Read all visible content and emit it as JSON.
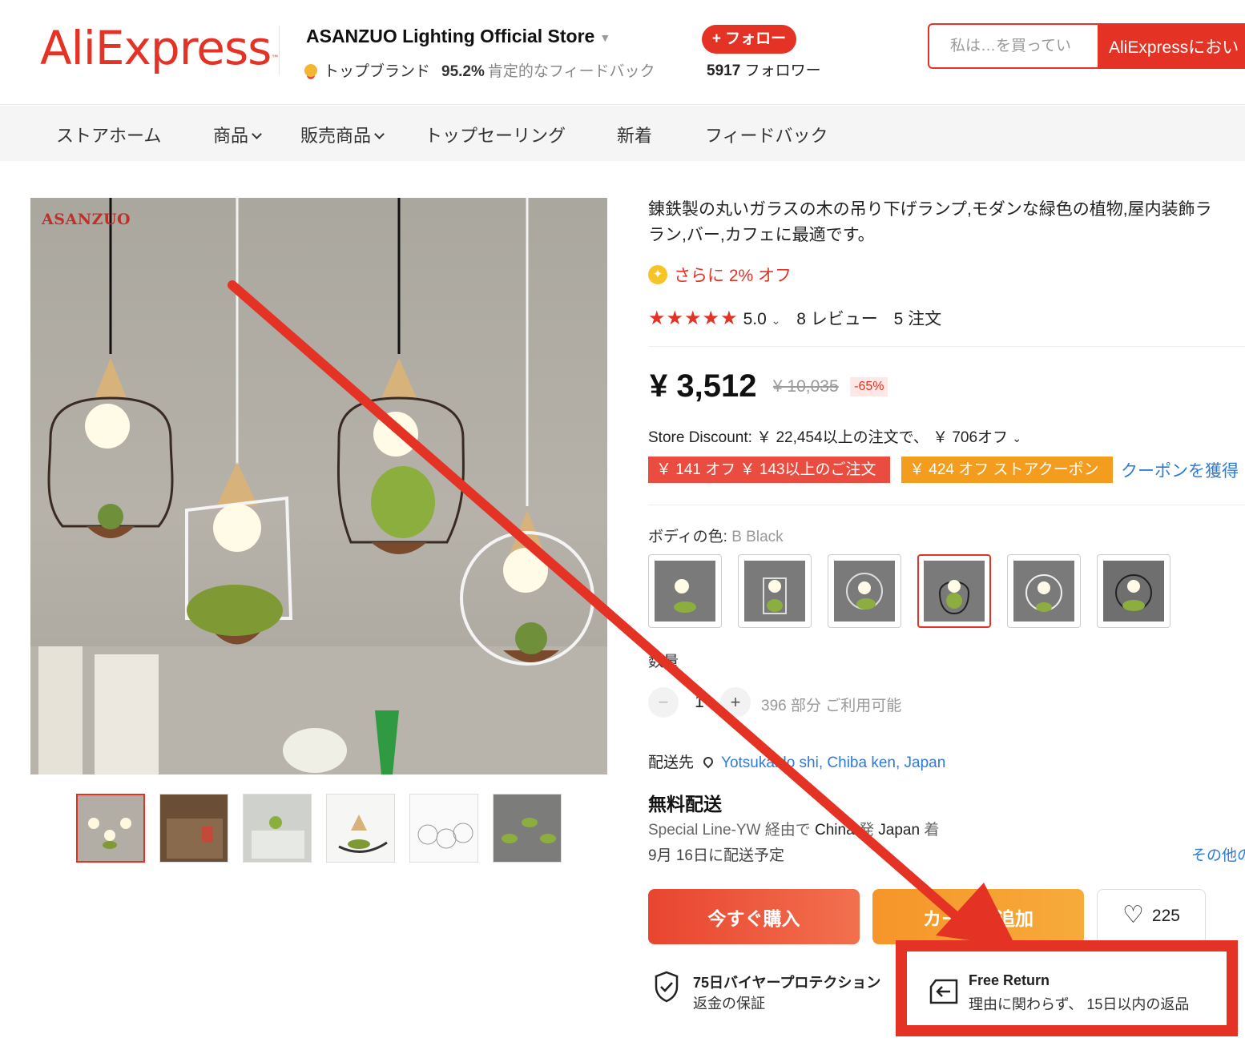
{
  "header": {
    "logo": "AliExpress",
    "logo_tm": "™",
    "store_name": "ASANZUO Lighting Official Store",
    "store_badge": "トップブランド",
    "feedback_pct": "95.2%",
    "feedback_label": "肯定的なフィードバック",
    "follow_label": "+ フォロー",
    "followers_count": "5917",
    "followers_label": "フォロワー",
    "search_placeholder": "私は…を買ってい",
    "search_button": "AliExpressにおい"
  },
  "nav": {
    "items": [
      "ストアホーム",
      "商品",
      "販売商品",
      "トップセーリング",
      "新着",
      "フィードバック"
    ]
  },
  "gallery": {
    "brand_mark": "ASANZUO",
    "thumbnail_count": 6,
    "active_thumbnail": 0
  },
  "product": {
    "title_line1": "錬鉄製の丸いガラスの木の吊り下げランプ,モダンな緑色の植物,屋内装飾ラ",
    "title_line2": "ラン,バー,カフェに最適です。",
    "extra_off": "さらに 2% オフ",
    "rating_value": "5.0",
    "rating_stars": 5,
    "reviews": "8 レビュー",
    "orders": "5 注文",
    "price": "¥ 3,512",
    "old_price": "¥ 10,035",
    "discount": "-65%",
    "store_discount": "Store Discount: ￥ 22,454以上の注文で、 ￥ 706オフ",
    "coupon1": "￥ 141 オフ ￥ 143以上のご注文",
    "coupon2": "￥ 424 オフ ストアクーポン",
    "get_coupon": "クーポンを獲得",
    "color_label": "ボディの色:",
    "color_value": "B Black",
    "swatch_count": 6,
    "active_swatch": 3,
    "qty_label": "数量",
    "qty_value": "1",
    "qty_minus": "−",
    "qty_plus": "+",
    "availability": "396 部分 ご利用可能",
    "ship_to_label": "配送先",
    "ship_to_location": "Yotsukaido shi, Chiba ken, Japan",
    "free_shipping": "無料配送",
    "ship_via_prefix": "Special Line-YW 経由で",
    "ship_from": "China",
    "ship_from_suffix": "発",
    "ship_to_country": "Japan",
    "ship_to_suffix": "着",
    "ship_date": "9月 16日に配送予定",
    "other_options": "その他の",
    "buy_now": "今すぐ購入",
    "add_to_cart": "カートに追加",
    "wishlist_count": "225",
    "protection_title": "75日バイヤープロテクション",
    "protection_sub": "返金の保証",
    "free_return_title": "Free Return",
    "free_return_sub": "理由に関わらず、 15日以内の返品"
  },
  "colors": {
    "accent": "#e43225",
    "link": "#2f7bd6",
    "orange": "#f39c1e"
  }
}
